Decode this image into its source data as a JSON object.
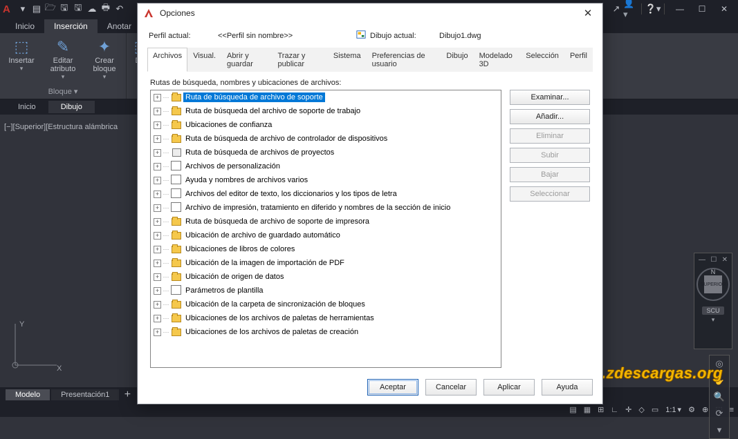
{
  "app": {
    "logo": "A"
  },
  "menubar": [
    "Inicio",
    "Inserción",
    "Anotar"
  ],
  "menubar_active": 1,
  "ribbon": {
    "items": [
      {
        "label": "Insertar"
      },
      {
        "label": "Editar atributo"
      },
      {
        "label": "Crear bloque"
      }
    ],
    "group_label": "Bloque ▾",
    "def_label": "Def"
  },
  "drawing_tabs": [
    "Inicio",
    "Dibujo"
  ],
  "drawing_tabs_active": 1,
  "view_label": "[−][Superior][Estructura alámbrica",
  "axes": {
    "x": "X",
    "y": "Y"
  },
  "viewcube": {
    "north": "N",
    "face": "SUPERIOR",
    "scu": "SCU"
  },
  "layout_tabs": [
    "Modelo",
    "Presentación1"
  ],
  "layout_tabs_active": 0,
  "statusbar": {
    "scale": "1:1",
    "gear": "⚙"
  },
  "watermark": "www.zdescargas.org",
  "dialog": {
    "title": "Opciones",
    "profile_label": "Perfil actual:",
    "profile_value": "<<Perfil sin nombre>>",
    "drawing_label": "Dibujo actual:",
    "drawing_value": "Dibujo1.dwg",
    "tabs": [
      "Archivos",
      "Visual.",
      "Abrir y guardar",
      "Trazar y publicar",
      "Sistema",
      "Preferencias de usuario",
      "Dibujo",
      "Modelado 3D",
      "Selección",
      "Perfil"
    ],
    "tabs_active": 0,
    "tree_label": "Rutas de búsqueda, nombres y ubicaciones de archivos:",
    "tree": [
      {
        "icon": "folder",
        "label": "Ruta de búsqueda de archivo de soporte",
        "selected": true
      },
      {
        "icon": "folder",
        "label": "Ruta de búsqueda del archivo de soporte de trabajo"
      },
      {
        "icon": "folder",
        "label": "Ubicaciones de confianza"
      },
      {
        "icon": "folder",
        "label": "Ruta de búsqueda de archivo de controlador de dispositivos"
      },
      {
        "icon": "box",
        "label": "Ruta de búsqueda de archivos de proyectos"
      },
      {
        "icon": "stack",
        "label": "Archivos de personalización"
      },
      {
        "icon": "stack",
        "label": "Ayuda y nombres de archivos varios"
      },
      {
        "icon": "stack",
        "label": "Archivos del editor de texto, los diccionarios y los tipos de letra"
      },
      {
        "icon": "stack",
        "label": "Archivo de impresión, tratamiento en diferido y nombres de la sección de inicio"
      },
      {
        "icon": "folder",
        "label": "Ruta de búsqueda de archivo de soporte de impresora"
      },
      {
        "icon": "folder",
        "label": "Ubicación de archivo de guardado automático"
      },
      {
        "icon": "folder",
        "label": "Ubicaciones de libros de colores"
      },
      {
        "icon": "folder",
        "label": "Ubicación de la imagen de importación de PDF"
      },
      {
        "icon": "folder",
        "label": "Ubicación de origen de datos"
      },
      {
        "icon": "stack",
        "label": "Parámetros de plantilla"
      },
      {
        "icon": "folder",
        "label": "Ubicación de la carpeta de sincronización de bloques"
      },
      {
        "icon": "folder",
        "label": "Ubicaciones de los archivos de paletas de herramientas"
      },
      {
        "icon": "folder",
        "label": "Ubicaciones de los archivos de paletas de creación"
      }
    ],
    "buttons": {
      "browse": "Examinar...",
      "add": "Añadir...",
      "delete": "Eliminar",
      "up": "Subir",
      "down": "Bajar",
      "select": "Seleccionar"
    },
    "footer": {
      "ok": "Aceptar",
      "cancel": "Cancelar",
      "apply": "Aplicar",
      "help": "Ayuda"
    }
  }
}
